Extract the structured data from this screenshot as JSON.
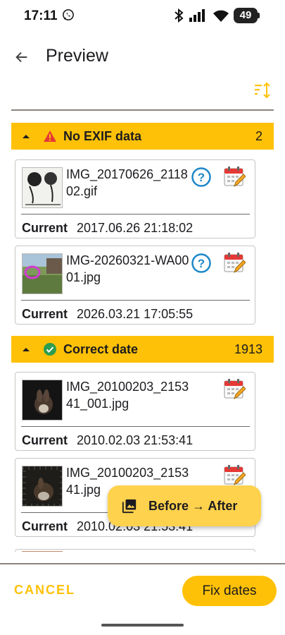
{
  "status_bar": {
    "time": "17:11",
    "battery": "49",
    "icons": [
      "whatsapp-icon",
      "bluetooth-icon",
      "signal-icon",
      "wifi-icon",
      "battery-icon"
    ]
  },
  "app_bar": {
    "title": "Preview",
    "back_icon": "arrow-left-icon",
    "sort_icon": "sort-icon"
  },
  "groups": [
    {
      "label": "No EXIF data",
      "count": "2",
      "icon": "warning-icon",
      "items": [
        {
          "filename": "IMG_20170626_211802.gif",
          "current_label": "Current",
          "current_value": "2017.06.26 21:18:02"
        },
        {
          "filename": "IMG-20260321-WA0001.jpg",
          "current_label": "Current",
          "current_value": "2026.03.21 17:05:55"
        }
      ]
    },
    {
      "label": "Correct date",
      "count": "1913",
      "icon": "check-circle-icon",
      "items": [
        {
          "filename": "IMG_20100203_215341_001.jpg",
          "current_label": "Current",
          "current_value": "2010.02.03 21:53:41"
        },
        {
          "filename": "IMG_20100203_215341.jpg",
          "current_label": "Current",
          "current_value": "2010.02.03 21:53:41"
        }
      ]
    }
  ],
  "fab": {
    "label": "Before → After",
    "icon": "photo-library-icon"
  },
  "actions": {
    "cancel": "CANCEL",
    "confirm": "Fix dates"
  },
  "colors": {
    "accent": "#ffc107",
    "fab": "#ffd24d",
    "help": "#1e88c8",
    "check": "#2e9d4f",
    "warning": "#e53935"
  }
}
